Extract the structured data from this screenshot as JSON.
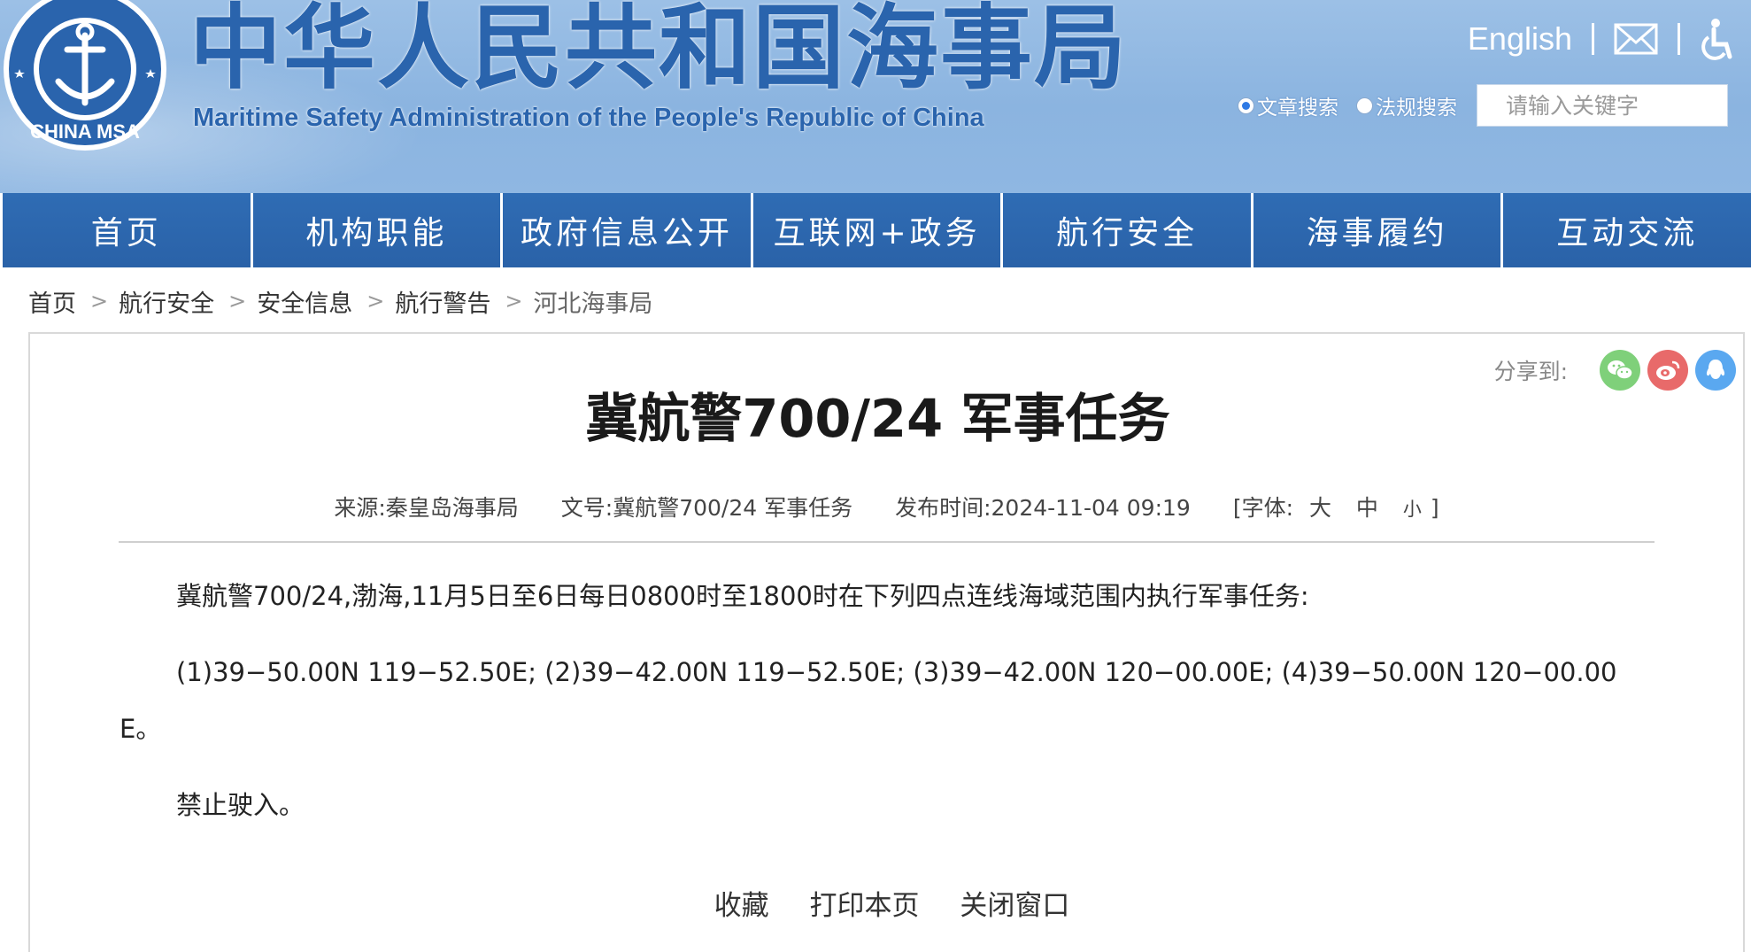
{
  "header": {
    "title": "中华人民共和国海事局",
    "subtitle": "Maritime Safety Administration of the People's Republic of China",
    "emblem_text": "中国海事局 CHINA MSA",
    "english_link": "English",
    "mail_icon": "mail-icon",
    "accessibility_icon": "accessibility-icon",
    "search": {
      "options": [
        "文章搜索",
        "法规搜索"
      ],
      "selected": "文章搜索",
      "placeholder": "请输入关键字"
    }
  },
  "nav": {
    "items": [
      "首页",
      "机构职能",
      "政府信息公开",
      "互联网+政务",
      "航行安全",
      "海事履约",
      "互动交流"
    ]
  },
  "breadcrumb": {
    "items": [
      "首页",
      "航行安全",
      "安全信息",
      "航行警告",
      "河北海事局"
    ],
    "separator": ">"
  },
  "article": {
    "share_label": "分享到:",
    "share_icons": [
      "wechat-icon",
      "weibo-icon",
      "qq-icon"
    ],
    "title": "冀航警700/24 军事任务",
    "meta": {
      "source": "来源:秦皇岛海事局",
      "doc_no": "文号:冀航警700/24 军事任务",
      "published": "发布时间:2024-11-04 09:19",
      "font_label": "[字体:",
      "font_large": "大",
      "font_medium": "中",
      "font_small": "小",
      "font_close": "]"
    },
    "paragraphs": [
      "冀航警700/24,渤海,11月5日至6日每日0800时至1800时在下列四点连线海域范围内执行军事任务:",
      " (1)39−50.00N 119−52.50E; (2)39−42.00N 119−52.50E; (3)39−42.00N 120−00.00E; (4)39−50.00N 120−00.00E。",
      "禁止驶入。"
    ],
    "actions": [
      "收藏",
      "打印本页",
      "关闭窗口"
    ]
  },
  "colors": {
    "header_bg": "#8fb7e2",
    "brand_blue": "#2a64ad",
    "nav_bg": "#2c67b0",
    "wechat": "#7fd07a",
    "weibo": "#e86a6a",
    "qq": "#5aa8f0"
  }
}
